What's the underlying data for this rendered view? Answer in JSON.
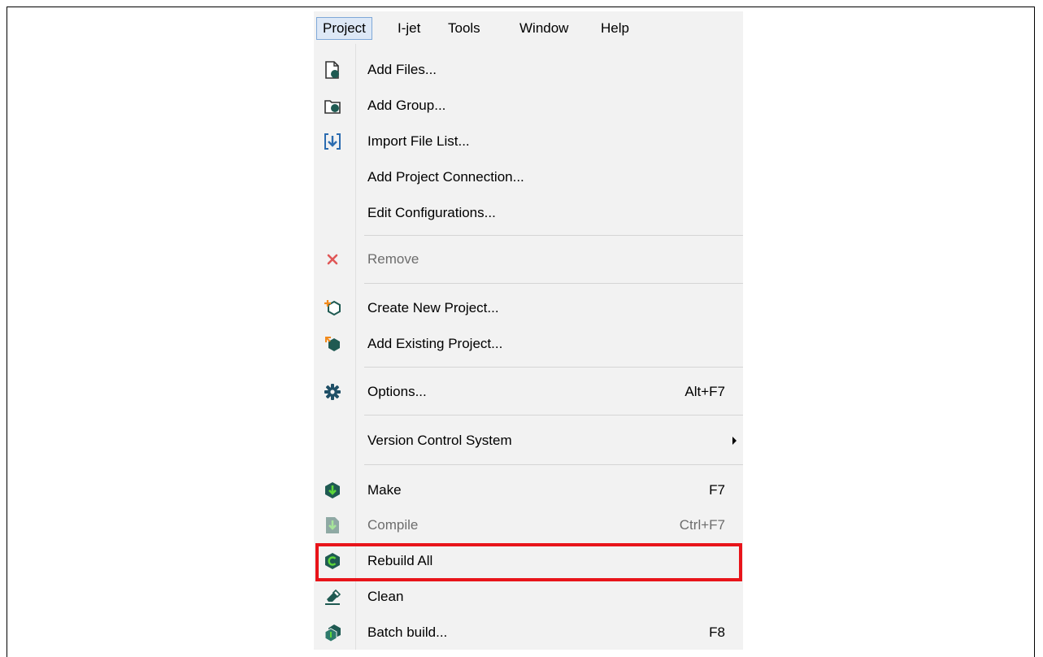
{
  "menubar": {
    "items": [
      {
        "label": "Project"
      },
      {
        "label": "I-jet"
      },
      {
        "label": "Tools"
      },
      {
        "label": "Window"
      },
      {
        "label": "Help"
      }
    ]
  },
  "menu": {
    "items": [
      {
        "label": "Add Files...",
        "icon": "add-files-icon"
      },
      {
        "label": "Add Group...",
        "icon": "add-group-icon"
      },
      {
        "label": "Import File List...",
        "icon": "import-list-icon"
      },
      {
        "label": "Add Project Connection..."
      },
      {
        "label": "Edit Configurations..."
      },
      {
        "label": "Remove",
        "icon": "remove-x-icon",
        "disabled": true
      },
      {
        "label": "Create New Project...",
        "icon": "new-project-icon"
      },
      {
        "label": "Add Existing Project...",
        "icon": "existing-project-icon"
      },
      {
        "label": "Options...",
        "shortcut": "Alt+F7",
        "icon": "gear-icon"
      },
      {
        "label": "Version Control System",
        "submenu": true
      },
      {
        "label": "Make",
        "shortcut": "F7",
        "icon": "make-icon"
      },
      {
        "label": "Compile",
        "shortcut": "Ctrl+F7",
        "icon": "compile-icon",
        "disabled": true
      },
      {
        "label": "Rebuild All",
        "icon": "rebuild-icon",
        "highlighted": true
      },
      {
        "label": "Clean",
        "icon": "clean-eraser-icon"
      },
      {
        "label": "Batch build...",
        "shortcut": "F8",
        "icon": "batch-build-icon"
      }
    ]
  },
  "colors": {
    "highlight_box": "#e8141a",
    "menu_background": "#f2f2f2",
    "icon_dark_green": "#1f5a52",
    "icon_arrow_green": "#5cd63a",
    "icon_blue": "#2b6cb0"
  }
}
